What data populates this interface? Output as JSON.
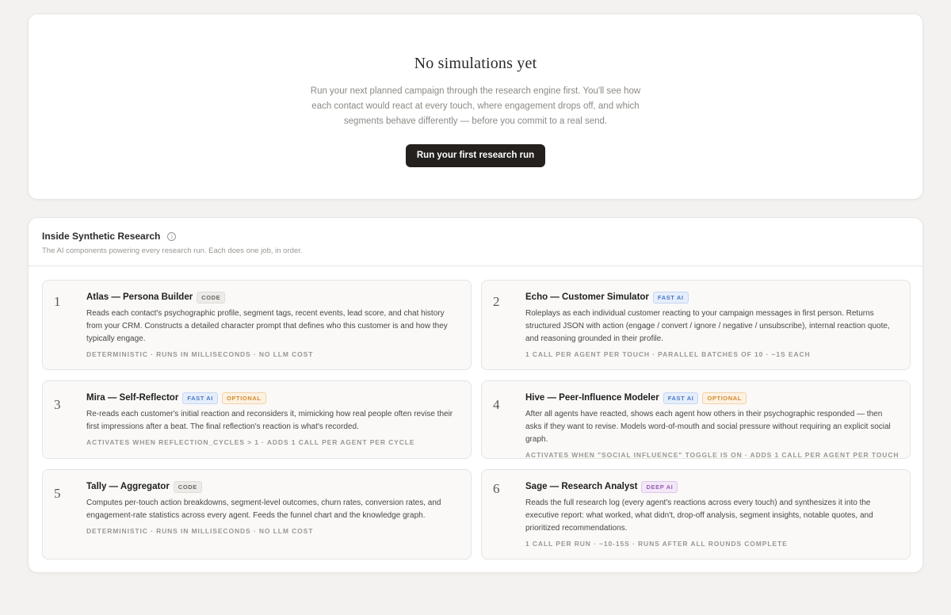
{
  "empty_state": {
    "title": "No simulations yet",
    "description": "Run your next planned campaign through the research engine first. You'll see how each contact would react at every touch, where engagement drops off, and which segments behave differently — before you commit to a real send.",
    "cta_label": "Run your first research run"
  },
  "inside": {
    "title": "Inside Synthetic Research",
    "info_icon": "i",
    "subtitle": "The AI components powering every research run. Each does one job, in order.",
    "agents": [
      {
        "number": "1",
        "name": "Atlas — Persona Builder",
        "badges": [
          "CODE"
        ],
        "description": "Reads each contact's psychographic profile, segment tags, recent events, lead score, and chat history from your CRM. Constructs a detailed character prompt that defines who this customer is and how they typically engage.",
        "meta": "DETERMINISTIC · RUNS IN MILLISECONDS · NO LLM COST"
      },
      {
        "number": "2",
        "name": "Echo — Customer Simulator",
        "badges": [
          "FAST AI"
        ],
        "description": "Roleplays as each individual customer reacting to your campaign messages in first person. Returns structured JSON with action (engage / convert / ignore / negative / unsubscribe), internal reaction quote, and reasoning grounded in their profile.",
        "meta": "1 CALL PER AGENT PER TOUCH · PARALLEL BATCHES OF 10 · ~1S EACH"
      },
      {
        "number": "3",
        "name": "Mira — Self-Reflector",
        "badges": [
          "FAST AI",
          "OPTIONAL"
        ],
        "description": "Re-reads each customer's initial reaction and reconsiders it, mimicking how real people often revise their first impressions after a beat. The final reflection's reaction is what's recorded.",
        "meta": "ACTIVATES WHEN REFLECTION_CYCLES > 1 · ADDS 1 CALL PER AGENT PER CYCLE"
      },
      {
        "number": "4",
        "name": "Hive — Peer-Influence Modeler",
        "badges": [
          "FAST AI",
          "OPTIONAL"
        ],
        "description": "After all agents have reacted, shows each agent how others in their psychographic responded — then asks if they want to revise. Models word-of-mouth and social pressure without requiring an explicit social graph.",
        "meta": "ACTIVATES WHEN \"SOCIAL INFLUENCE\" TOGGLE IS ON · ADDS 1 CALL PER AGENT PER TOUCH"
      },
      {
        "number": "5",
        "name": "Tally — Aggregator",
        "badges": [
          "CODE"
        ],
        "description": "Computes per-touch action breakdowns, segment-level outcomes, churn rates, conversion rates, and engagement-rate statistics across every agent. Feeds the funnel chart and the knowledge graph.",
        "meta": "DETERMINISTIC · RUNS IN MILLISECONDS · NO LLM COST"
      },
      {
        "number": "6",
        "name": "Sage — Research Analyst",
        "badges": [
          "DEEP AI"
        ],
        "description": "Reads the full research log (every agent's reactions across every touch) and synthesizes it into the executive report: what worked, what didn't, drop-off analysis, segment insights, notable quotes, and prioritized recommendations.",
        "meta": "1 CALL PER RUN · ~10-15S · RUNS AFTER ALL ROUNDS COMPLETE"
      }
    ]
  },
  "colors": {
    "background": "#f3f2f0",
    "cta": "#23201e",
    "badge_code": "#6a6762",
    "badge_fast_ai": "#4a78c9",
    "badge_optional": "#d18c2e",
    "badge_deep_ai": "#9a5db5"
  }
}
